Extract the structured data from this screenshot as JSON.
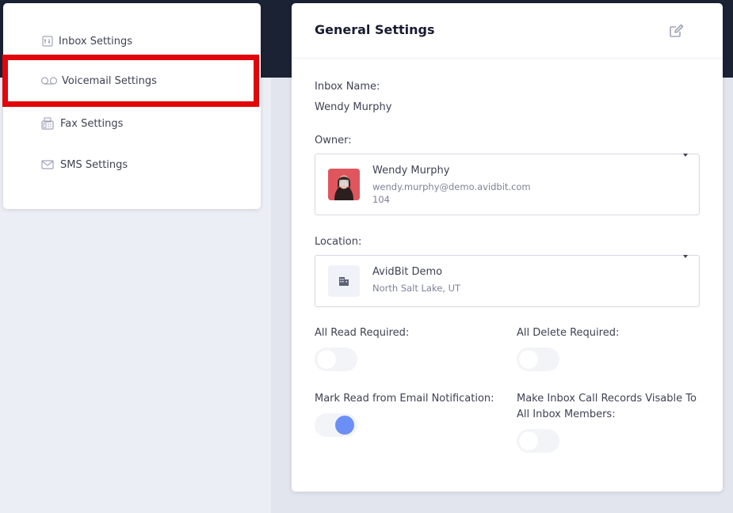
{
  "nav": {
    "items": [
      {
        "label": "Inbox Settings",
        "icon": "inbox-settings-icon"
      },
      {
        "label": "Voicemail Settings",
        "icon": "voicemail-icon",
        "selected": true
      },
      {
        "label": "Fax Settings",
        "icon": "fax-icon"
      },
      {
        "label": "SMS Settings",
        "icon": "envelope-icon"
      }
    ]
  },
  "main": {
    "title": "General Settings",
    "inbox_name_label": "Inbox Name:",
    "inbox_name_value": "Wendy Murphy",
    "owner_label": "Owner:",
    "owner": {
      "name": "Wendy Murphy",
      "email": "wendy.murphy@demo.avidbit.com",
      "extension": "104"
    },
    "location_label": "Location:",
    "location": {
      "name": "AvidBit Demo",
      "address": "North Salt Lake, UT"
    },
    "toggles": {
      "all_read_required": {
        "label": "All Read Required:",
        "on": false
      },
      "all_delete_required": {
        "label": "All Delete Required:",
        "on": false
      },
      "mark_read_email": {
        "label": "Mark Read from Email Notification:",
        "on": true
      },
      "make_visible": {
        "label_line1": "Make Inbox Call Records Visable To",
        "label_line2": "All Inbox Members:",
        "on": false
      }
    }
  },
  "colors": {
    "header": "#1a2234",
    "highlight": "#e1060b",
    "toggle_on": "#6c8ff5",
    "toggle_off": "#f3f4f8"
  }
}
